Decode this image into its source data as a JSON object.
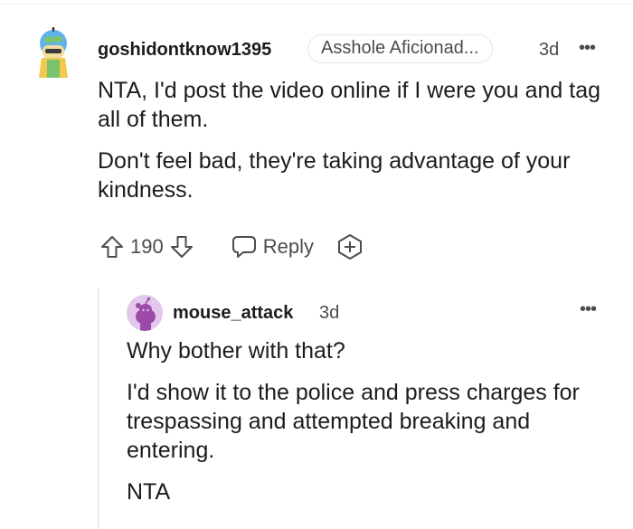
{
  "comment": {
    "author": "goshidontknow1395",
    "flair": "Asshole Aficionad...",
    "time": "3d",
    "more_label": "•••",
    "paragraphs": [
      "NTA, I'd post the video online if I were you and tag all of them.",
      "Don't feel bad, they're taking advantage of your kindness."
    ],
    "vote_count": "190",
    "reply_label": "Reply",
    "upvote_icon": "arrow-up-icon",
    "downvote_icon": "arrow-down-icon",
    "reply_icon": "speech-bubble-icon",
    "award_icon": "award-plus-icon"
  },
  "reply": {
    "author": "mouse_attack",
    "time": "3d",
    "more_label": "•••",
    "paragraphs": [
      "Why bother with that?",
      "I'd show it to the police and press charges for trespassing and attempted breaking and entering.",
      "NTA"
    ],
    "avatar_color": "#e4c7ed"
  },
  "colors": {
    "text": "#1c1c1c",
    "meta": "#4a4c4f",
    "divider": "#edeff1"
  }
}
